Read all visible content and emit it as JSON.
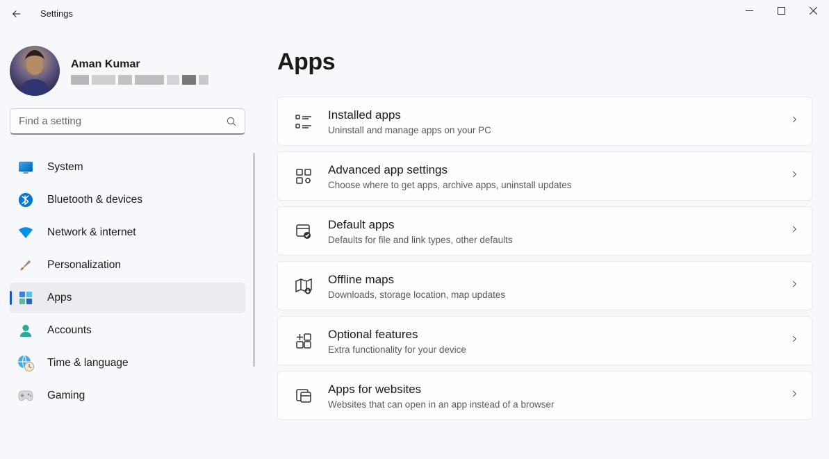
{
  "window": {
    "app_title": "Settings"
  },
  "profile": {
    "name": "Aman Kumar"
  },
  "search": {
    "placeholder": "Find a setting"
  },
  "sidebar": {
    "items": [
      {
        "label": "System"
      },
      {
        "label": "Bluetooth & devices"
      },
      {
        "label": "Network & internet"
      },
      {
        "label": "Personalization"
      },
      {
        "label": "Apps"
      },
      {
        "label": "Accounts"
      },
      {
        "label": "Time & language"
      },
      {
        "label": "Gaming"
      }
    ]
  },
  "page": {
    "title": "Apps"
  },
  "cards": [
    {
      "title": "Installed apps",
      "sub": "Uninstall and manage apps on your PC"
    },
    {
      "title": "Advanced app settings",
      "sub": "Choose where to get apps, archive apps, uninstall updates"
    },
    {
      "title": "Default apps",
      "sub": "Defaults for file and link types, other defaults"
    },
    {
      "title": "Offline maps",
      "sub": "Downloads, storage location, map updates"
    },
    {
      "title": "Optional features",
      "sub": "Extra functionality for your device"
    },
    {
      "title": "Apps for websites",
      "sub": "Websites that can open in an app instead of a browser"
    }
  ]
}
